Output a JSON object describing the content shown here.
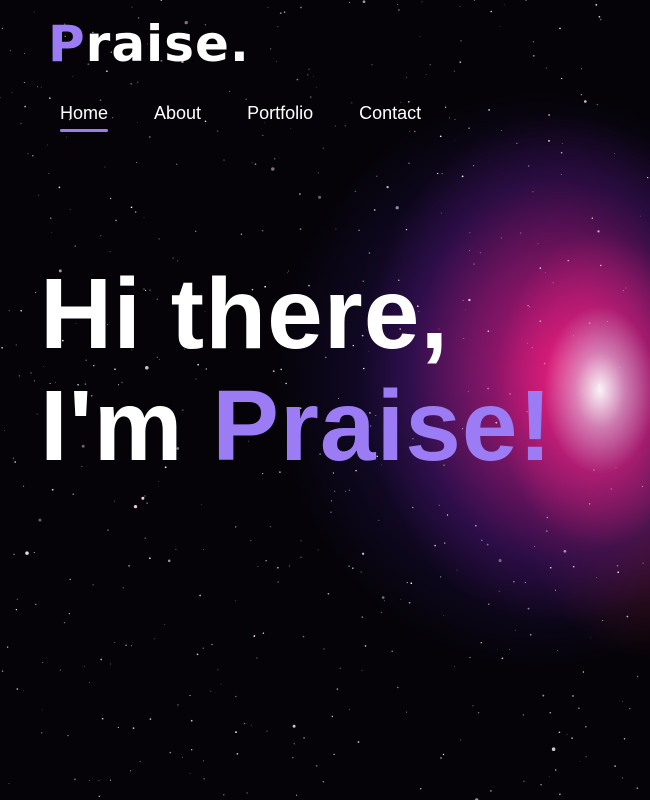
{
  "colors": {
    "accent": "#9b7cf5",
    "text": "#ffffff",
    "background": "#050308"
  },
  "brand": {
    "logo_first_letter": "P",
    "logo_rest": "raise."
  },
  "nav": {
    "items": [
      {
        "label": "Home",
        "active": true
      },
      {
        "label": "About",
        "active": false
      },
      {
        "label": "Portfolio",
        "active": false
      },
      {
        "label": "Contact",
        "active": false
      }
    ]
  },
  "hero": {
    "line1": "Hi there,",
    "line2_prefix": "I'm ",
    "line2_name": "Praise!"
  }
}
